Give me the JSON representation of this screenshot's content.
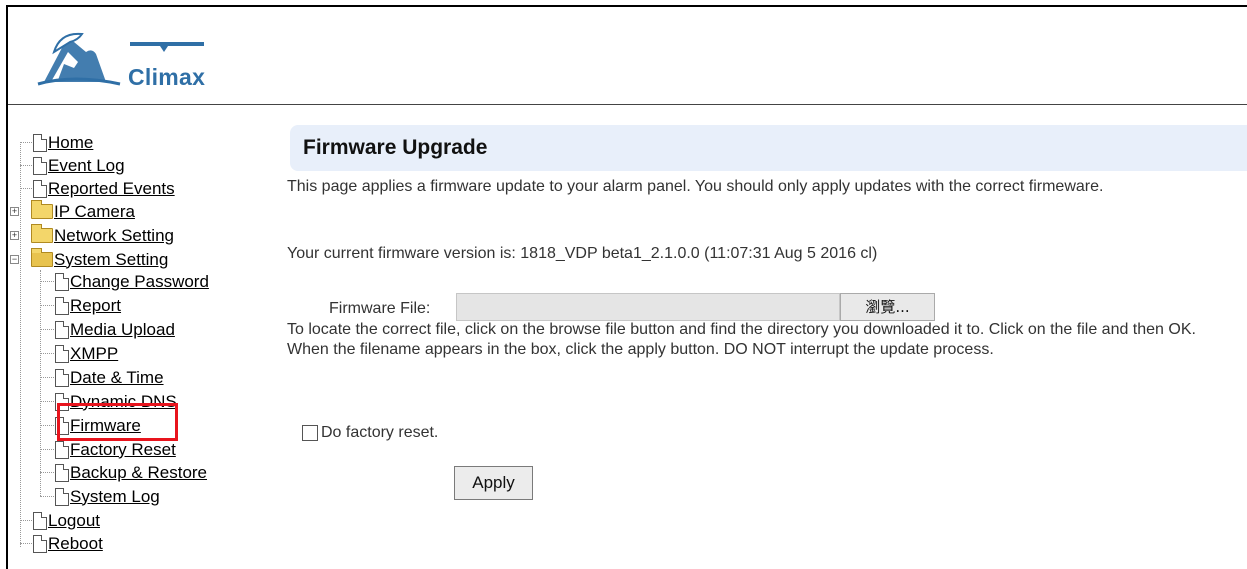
{
  "brand": {
    "logo_text": "Climax"
  },
  "nav": {
    "home": "Home",
    "event_log": "Event Log",
    "reported_events": "Reported Events",
    "ip_camera": "IP Camera",
    "network_setting": "Network Setting",
    "system_setting": "System Setting",
    "change_password": "Change Password",
    "report": "Report",
    "media_upload": "Media Upload",
    "xmpp": "XMPP",
    "date_time": "Date & Time",
    "dynamic_dns": "Dynamic DNS",
    "firmware": "Firmware",
    "factory_reset": "Factory Reset",
    "backup_restore": "Backup & Restore",
    "system_log": "System Log",
    "logout": "Logout",
    "reboot": "Reboot"
  },
  "page": {
    "title": "Firmware Upgrade",
    "description": "This page applies a firmware update to your alarm panel. You should only apply updates with the correct firmeware.",
    "version_text": "Your current firmware version is: 1818_VDP beta1_2.1.0.0 (11:07:31 Aug 5 2016 cl)",
    "file_label": "Firmware File:",
    "file_value": "",
    "browse_label": "瀏覽...",
    "help_text": "To locate the correct file, click on the browse file button and find the directory you downloaded it to. Click on the file and then OK. When the filename appears in the box, click the apply button. DO NOT interrupt the update process.",
    "factory_reset_label": "Do factory reset.",
    "factory_reset_checked": false,
    "apply_label": "Apply"
  },
  "colors": {
    "title_bar": "#e8effa",
    "highlight_box": "#e8141d",
    "logo_blue": "#2f6fa6"
  }
}
